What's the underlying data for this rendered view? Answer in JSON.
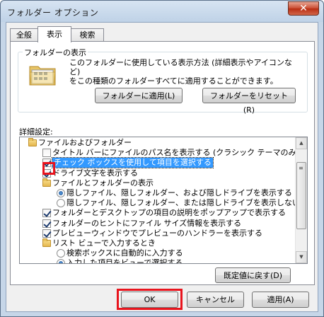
{
  "window": {
    "title": "フォルダー オプション",
    "close_glyph": "✕"
  },
  "tabs": [
    {
      "label": "全般",
      "active": false
    },
    {
      "label": "表示",
      "active": true
    },
    {
      "label": "検索",
      "active": false
    }
  ],
  "folder_view": {
    "group_label": "フォルダーの表示",
    "description": "このフォルダーに使用している表示方法 (詳細表示やアイコンなど)\nをこの種類のフォルダーすべてに適用することができます。",
    "apply_button": "フォルダーに適用(L)",
    "reset_button": "フォルダーをリセット(R)"
  },
  "advanced": {
    "label": "詳細設定:",
    "items": [
      {
        "type": "folder",
        "level": 0,
        "label": "ファイルおよびフォルダー"
      },
      {
        "type": "checkbox",
        "level": 1,
        "checked": false,
        "label": "タイトル バーにファイルのパス名を表示する (クラシック テーマのみ)"
      },
      {
        "type": "checkbox",
        "level": 1,
        "checked": true,
        "label": "チェック ボックスを使用して項目を選択する",
        "selected": true
      },
      {
        "type": "checkbox",
        "level": 1,
        "checked": true,
        "label": "ドライブ文字を表示する"
      },
      {
        "type": "folder",
        "level": 1,
        "label": "ファイルとフォルダーの表示"
      },
      {
        "type": "radio",
        "level": 2,
        "checked": true,
        "label": "隠しファイル、隠しフォルダー、および隠しドライブを表示する"
      },
      {
        "type": "radio",
        "level": 2,
        "checked": false,
        "label": "隠しファイル、隠しフォルダー、または隠しドライブを表示しない"
      },
      {
        "type": "checkbox",
        "level": 1,
        "checked": true,
        "label": "フォルダーとデスクトップの項目の説明をポップアップで表示する"
      },
      {
        "type": "checkbox",
        "level": 1,
        "checked": true,
        "label": "フォルダーのヒントにファイル サイズ情報を表示する"
      },
      {
        "type": "checkbox",
        "level": 1,
        "checked": true,
        "label": "プレビューウィンドウでプレビューのハンドラーを表示する"
      },
      {
        "type": "folder",
        "level": 1,
        "label": "リスト ビューで入力するとき"
      },
      {
        "type": "radio",
        "level": 2,
        "checked": false,
        "label": "検索ボックスに自動的に入力する"
      },
      {
        "type": "radio",
        "level": 2,
        "checked": true,
        "label": "入力した項目をビューで選択する"
      }
    ],
    "restore_button": "既定値に戻す(D)",
    "scroll_up_glyph": "▲",
    "scroll_down_glyph": "▼",
    "scroll_grip_glyph": "≡"
  },
  "footer": {
    "ok": "OK",
    "cancel": "キャンセル",
    "apply": "適用(A)"
  },
  "colors": {
    "selection": "#3399ff",
    "annotation_red": "#e8141d"
  }
}
